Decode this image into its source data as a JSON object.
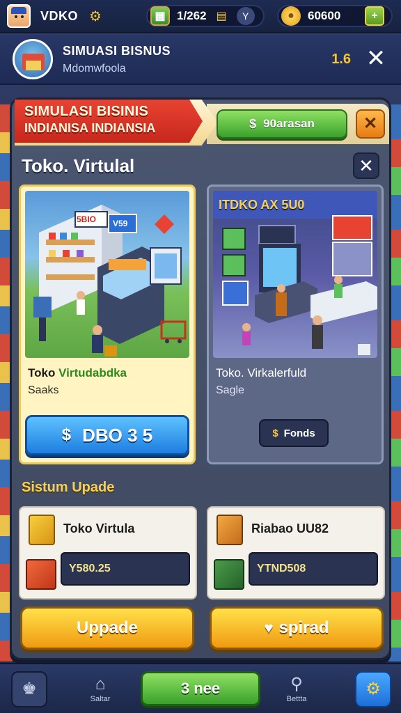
{
  "topbar": {
    "player_name": "VDKO",
    "resource_1": {
      "value": "1/262",
      "icon": "crate-icon"
    },
    "resource_1_extra": "Y",
    "resource_2": {
      "value": "60600",
      "icon": "coin-icon"
    },
    "add_label": "+"
  },
  "header": {
    "title": "SIMUASI BISNUS",
    "subtitle": "Mdomwfoola",
    "level": "1.6"
  },
  "panel": {
    "ribbon_line1": "SIMULASI BISINIS",
    "ribbon_line2": "INDIANISA INDIANSIA",
    "top_button_label": "90arasan",
    "section_title": "Toko. Virtulal",
    "card_left": {
      "title_prefix": "Toko ",
      "title_highlight": "Virtudabdka",
      "subtitle": "Saaks",
      "button_label": "DBO 3  5",
      "sign_1": "5BIO",
      "sign_2": "V59"
    },
    "card_right": {
      "banner": "ITDKO AX 5U0",
      "title": "Toko. Virkalerfuld",
      "subtitle": "Sagle",
      "button_label": "Fonds"
    },
    "system_title": "Sistum Upade",
    "upgrade_left": {
      "title": "Toko Virtula",
      "value": "Y580.25",
      "button_label": "Uppade"
    },
    "upgrade_right": {
      "title": "Riabao UU82",
      "value": "YTND508",
      "button_label": "spirad"
    }
  },
  "nav": {
    "item_1": "",
    "item_2": "Saltar",
    "center_label": "3 nee",
    "item_4": "Bettta",
    "item_5": ""
  },
  "colors": {
    "accent_gold": "#f7c531",
    "ribbon_red": "#e84332",
    "button_blue": "#1d7ee0",
    "button_green": "#3aa12a",
    "button_yellow": "#f09a12"
  }
}
